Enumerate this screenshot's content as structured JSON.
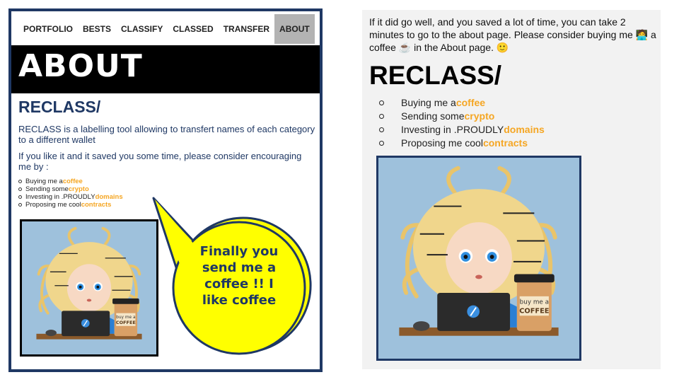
{
  "left": {
    "nav": [
      "PORTFOLIO",
      "BESTS",
      "CLASSIFY",
      "CLASSED",
      "TRANSFER",
      "ABOUT"
    ],
    "hero_title": "ABOUT",
    "heading": "RECLASS/",
    "para1": "RECLASS is a labelling tool allowing to transfert names of each category to a different wallet",
    "para2": "If you like it and it saved you some time, please consider encouraging me by :",
    "list": [
      {
        "prefix": "Buying me a ",
        "highlight": "coffee"
      },
      {
        "prefix": "Sending some ",
        "highlight": "crypto"
      },
      {
        "prefix": "Investing in .PROUDLY ",
        "highlight": "domains"
      },
      {
        "prefix": "Proposing me cool ",
        "highlight": "contracts"
      }
    ],
    "bubble_lines": [
      "Finally you",
      "send me a",
      "coffee !! I",
      "like coffee"
    ]
  },
  "right": {
    "intro_part1": "If it did go well, and you saved a lot of time, you can take 2 minutes to go to the about page.  Please consider buying me ",
    "intro_emoji1": "🧑‍💻",
    "intro_part2": " a coffee ",
    "intro_emoji2": "☕",
    "intro_part3": " in the About page. ",
    "intro_emoji3": "🙂",
    "heading": "RECLASS/",
    "list": [
      {
        "prefix": "Buying me a ",
        "highlight": "coffee"
      },
      {
        "prefix": "Sending some ",
        "highlight": "crypto"
      },
      {
        "prefix": "Investing in .PROUDLY ",
        "highlight": "domains"
      },
      {
        "prefix": "Proposing me cool ",
        "highlight": "contracts"
      }
    ]
  },
  "illustration": {
    "cup_text_line1": "buy me a",
    "cup_text_line2": "COFFEE"
  },
  "colors": {
    "accent": "#f5a623",
    "navy": "#1f3864",
    "bubble": "#ffff00"
  }
}
